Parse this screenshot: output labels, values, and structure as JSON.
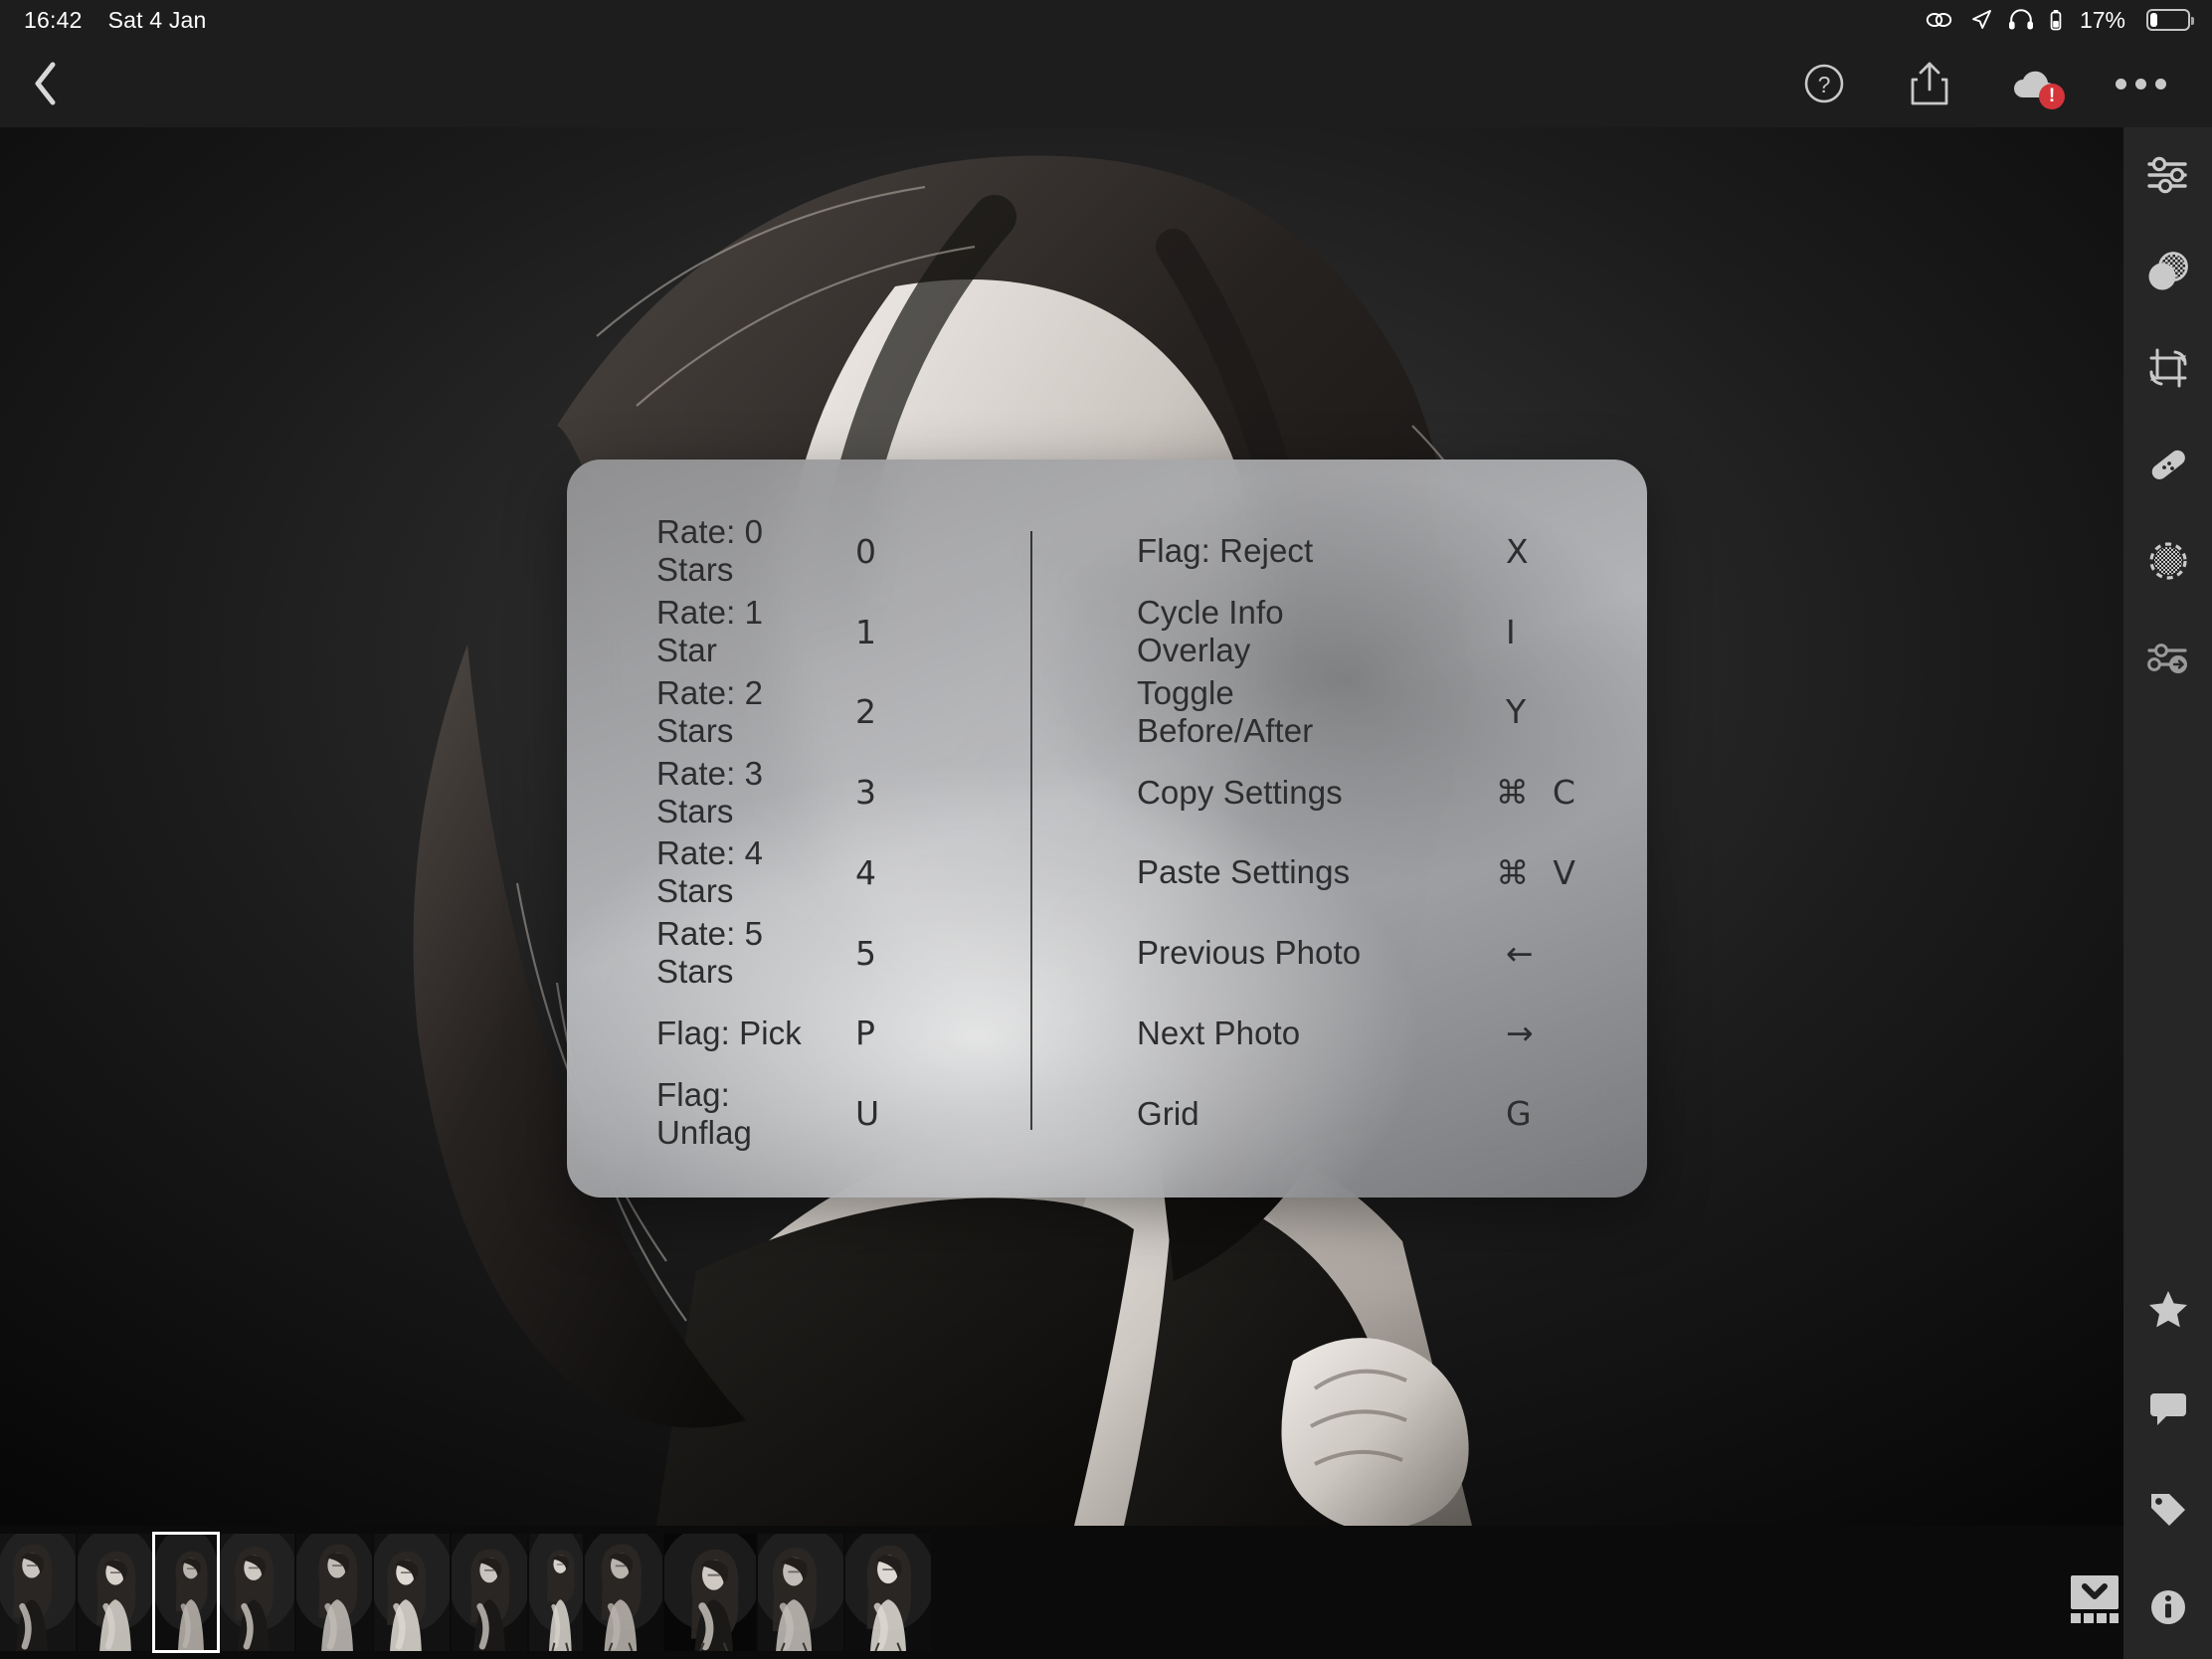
{
  "status_bar": {
    "time": "16:42",
    "date": "Sat 4 Jan",
    "battery_percent": "17%",
    "icons": [
      "link-icon",
      "location-arrow-icon",
      "headphones-icon",
      "headphone-battery-icon",
      "battery-icon"
    ]
  },
  "toolbar": {
    "back_label": "‹",
    "help_label": "?",
    "share_label": "share-icon",
    "cloud_badge": "!",
    "more_label": "more-icon"
  },
  "sidebar": {
    "top_items": [
      {
        "name": "edit-sliders",
        "label": "Edit"
      },
      {
        "name": "healing-overlay",
        "label": "Selective"
      },
      {
        "name": "crop-rotate",
        "label": "Crop"
      },
      {
        "name": "healing-brush",
        "label": "Healing"
      },
      {
        "name": "masking",
        "label": "Masking"
      },
      {
        "name": "presets",
        "label": "Presets"
      }
    ],
    "bottom_items": [
      {
        "name": "rating-star",
        "label": "Rating"
      },
      {
        "name": "comment",
        "label": "Comments"
      },
      {
        "name": "keyword-tag",
        "label": "Keywords"
      },
      {
        "name": "info",
        "label": "Info"
      }
    ]
  },
  "shortcut_panel": {
    "left_column": [
      {
        "label": "Rate: 0 Stars",
        "keys": [
          "0"
        ]
      },
      {
        "label": "Rate: 1 Star",
        "keys": [
          "1"
        ]
      },
      {
        "label": "Rate: 2 Stars",
        "keys": [
          "2"
        ]
      },
      {
        "label": "Rate: 3 Stars",
        "keys": [
          "3"
        ]
      },
      {
        "label": "Rate: 4 Stars",
        "keys": [
          "4"
        ]
      },
      {
        "label": "Rate: 5 Stars",
        "keys": [
          "5"
        ]
      },
      {
        "label": "Flag: Pick",
        "keys": [
          "P"
        ]
      },
      {
        "label": "Flag: Unflag",
        "keys": [
          "U"
        ]
      }
    ],
    "right_column": [
      {
        "label": "Flag: Reject",
        "keys": [
          "X"
        ]
      },
      {
        "label": "Cycle Info Overlay",
        "keys": [
          "I"
        ]
      },
      {
        "label": "Toggle Before/After",
        "keys": [
          "Y"
        ]
      },
      {
        "label": "Copy Settings",
        "keys": [
          "⌘",
          "C"
        ]
      },
      {
        "label": "Paste Settings",
        "keys": [
          "⌘",
          "V"
        ]
      },
      {
        "label": "Previous Photo",
        "keys": [
          "←"
        ]
      },
      {
        "label": "Next Photo",
        "keys": [
          "→"
        ]
      },
      {
        "label": "Grid",
        "keys": [
          "G"
        ]
      }
    ]
  },
  "filmstrip": {
    "selected_index": 2,
    "thumbnails": [
      {
        "width": 76,
        "variant": 0
      },
      {
        "width": 76,
        "variant": 1
      },
      {
        "width": 62,
        "variant": 2
      },
      {
        "width": 76,
        "variant": 3
      },
      {
        "width": 76,
        "variant": 4
      },
      {
        "width": 76,
        "variant": 5
      },
      {
        "width": 76,
        "variant": 6
      },
      {
        "width": 54,
        "variant": 7
      },
      {
        "width": 78,
        "variant": 8
      },
      {
        "width": 92,
        "variant": 9
      },
      {
        "width": 86,
        "variant": 10
      },
      {
        "width": 86,
        "variant": 11
      }
    ],
    "toggle_label": "filmstrip-collapse-icon"
  },
  "colors": {
    "chrome": "#1d1d1d",
    "sidebar": "#262626",
    "filmstrip": "#0b0b0b",
    "badge_red": "#d3353a",
    "panel_text": "#2d2d2f",
    "icon": "#c9c9c9"
  }
}
